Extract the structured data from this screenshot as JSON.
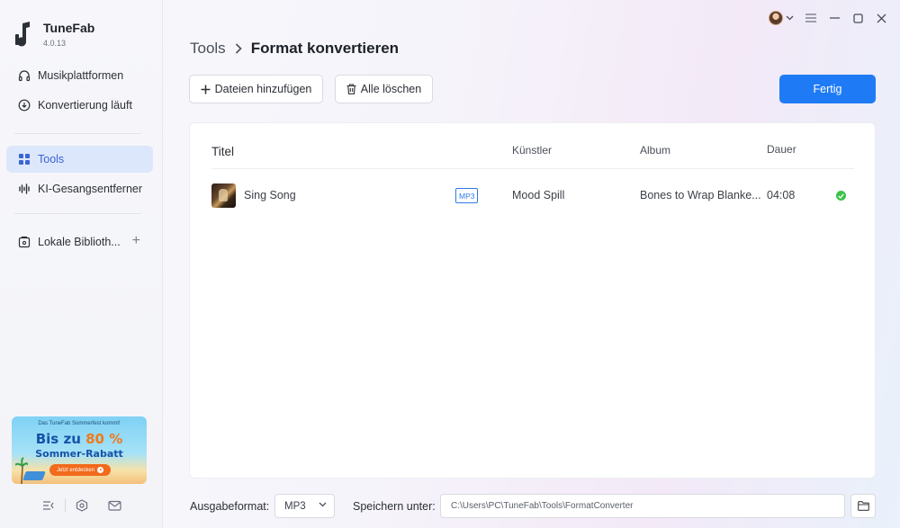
{
  "app": {
    "name": "TuneFab",
    "version": "4.0.13"
  },
  "sidebar": {
    "items": [
      {
        "label": "Musikplattformen",
        "icon": "headphones-icon"
      },
      {
        "label": "Konvertierung läuft",
        "icon": "download-circle-icon"
      },
      {
        "label": "Tools",
        "icon": "grid-icon",
        "active": true
      },
      {
        "label": "KI-Gesangsentferner",
        "icon": "waveform-icon"
      },
      {
        "label": "Lokale Biblioth...",
        "icon": "library-icon"
      }
    ],
    "add_icon": "plus-icon",
    "promo": {
      "top_text": "Das TuneFab Sommerfest kommt!",
      "headline_prefix": "Bis zu",
      "headline_value": "80 %",
      "subline": "Sommer-Rabatt",
      "button": "Jetzt entdecken"
    },
    "bottom_icons": [
      "collapse-sidebar-icon",
      "settings-hex-icon",
      "mail-icon"
    ]
  },
  "breadcrumb": {
    "parent": "Tools",
    "separator": ">",
    "current": "Format konvertieren"
  },
  "toolbar": {
    "add_files": "Dateien hinzufügen",
    "clear_all": "Alle löschen",
    "done": "Fertig"
  },
  "table": {
    "columns": {
      "title": "Titel",
      "artist": "Künstler",
      "album": "Album",
      "duration": "Dauer"
    },
    "rows": [
      {
        "title": "Sing Song",
        "format": "MP3",
        "artist": "Mood Spill",
        "album": "Bones to Wrap Blanke...",
        "duration": "04:08",
        "status": "done"
      }
    ]
  },
  "footer": {
    "format_label": "Ausgabeformat:",
    "format_value": "MP3",
    "save_label": "Speichern unter:",
    "save_path": "C:\\Users\\PC\\TuneFab\\Tools\\FormatConverter"
  },
  "colors": {
    "accent": "#1f7bf5",
    "active_bg": "#dde7fb",
    "success": "#3cc24a"
  }
}
